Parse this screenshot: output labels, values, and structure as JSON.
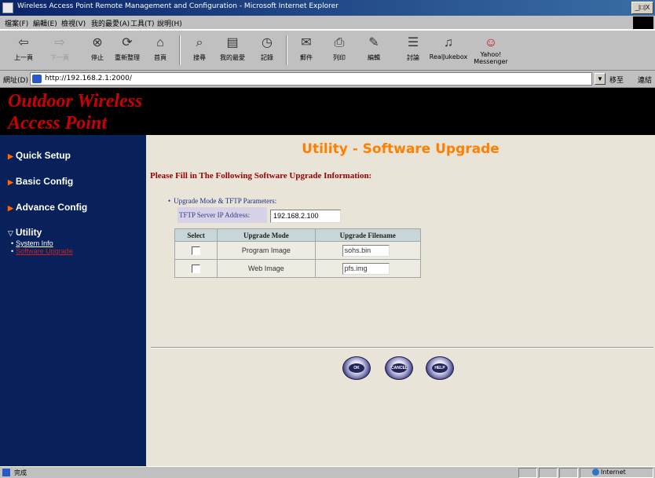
{
  "window": {
    "title": "Wireless Access Point Remote Management and Configuration - Microsoft Internet Explorer",
    "controls_label": "_|□|X"
  },
  "menu": {
    "items": [
      "檔案(F)",
      "編輯(E)",
      "檢視(V)",
      "我的最愛(A)",
      "工具(T)",
      "說明(H)"
    ]
  },
  "toolbar": {
    "buttons": [
      {
        "label": "上一頁",
        "icon": "back-arrow-icon",
        "glyph": "⇦"
      },
      {
        "label": "下一頁",
        "icon": "forward-arrow-icon",
        "glyph": "⇨"
      },
      {
        "label": "停止",
        "icon": "stop-icon",
        "glyph": "⊗"
      },
      {
        "label": "重新整理",
        "icon": "refresh-icon",
        "glyph": "⟳"
      },
      {
        "label": "首頁",
        "icon": "home-icon",
        "glyph": "⌂"
      },
      {
        "label": "搜尋",
        "icon": "search-icon",
        "glyph": "⌕"
      },
      {
        "label": "我的最愛",
        "icon": "favorites-icon",
        "glyph": "▤"
      },
      {
        "label": "記錄",
        "icon": "history-icon",
        "glyph": "◷"
      },
      {
        "label": "郵件",
        "icon": "mail-icon",
        "glyph": "✉"
      },
      {
        "label": "列印",
        "icon": "print-icon",
        "glyph": "⎙"
      },
      {
        "label": "編輯",
        "icon": "edit-icon",
        "glyph": "✎"
      },
      {
        "label": "討論",
        "icon": "discuss-icon",
        "glyph": "☰"
      },
      {
        "label": "RealJukebox",
        "icon": "realjukebox-icon",
        "glyph": "♫"
      },
      {
        "label": "Yahoo!",
        "label2": "Messenger",
        "icon": "yahoo-messenger-icon",
        "glyph": "☺"
      }
    ]
  },
  "address": {
    "label": "網址(D)",
    "value": "http://192.168.2.1:2000/",
    "go_label": "移至",
    "links_label": "連結"
  },
  "banner": {
    "line1": "Outdoor Wireless",
    "line2": "Access Point"
  },
  "sidebar": {
    "items": [
      {
        "label": "Quick Setup"
      },
      {
        "label": "Basic Config"
      },
      {
        "label": "Advance Config"
      },
      {
        "label": "Utility"
      }
    ],
    "utility_sub": [
      {
        "label": "System Info"
      },
      {
        "label": "Software Upgrade"
      }
    ]
  },
  "main": {
    "title": "Utility - Software Upgrade",
    "instructions": "Please Fill in The Following Software Upgrade Information:",
    "section_head": "Upgrade Mode & TFTP Parameters:",
    "tftp_label": "TFTP Server IP Address:",
    "tftp_value": "192.168.2.100",
    "table": {
      "headers": [
        "Select",
        "Upgrade Mode",
        "Upgrade Filename"
      ],
      "rows": [
        {
          "mode": "Program Image",
          "filename": "sohs.bin"
        },
        {
          "mode": "Web Image",
          "filename": "pfs.img"
        }
      ]
    },
    "buttons": {
      "ok": "OK",
      "cancel": "CANCEL",
      "help": "HELP"
    }
  },
  "status": {
    "text": "完成",
    "zone": "Internet"
  }
}
